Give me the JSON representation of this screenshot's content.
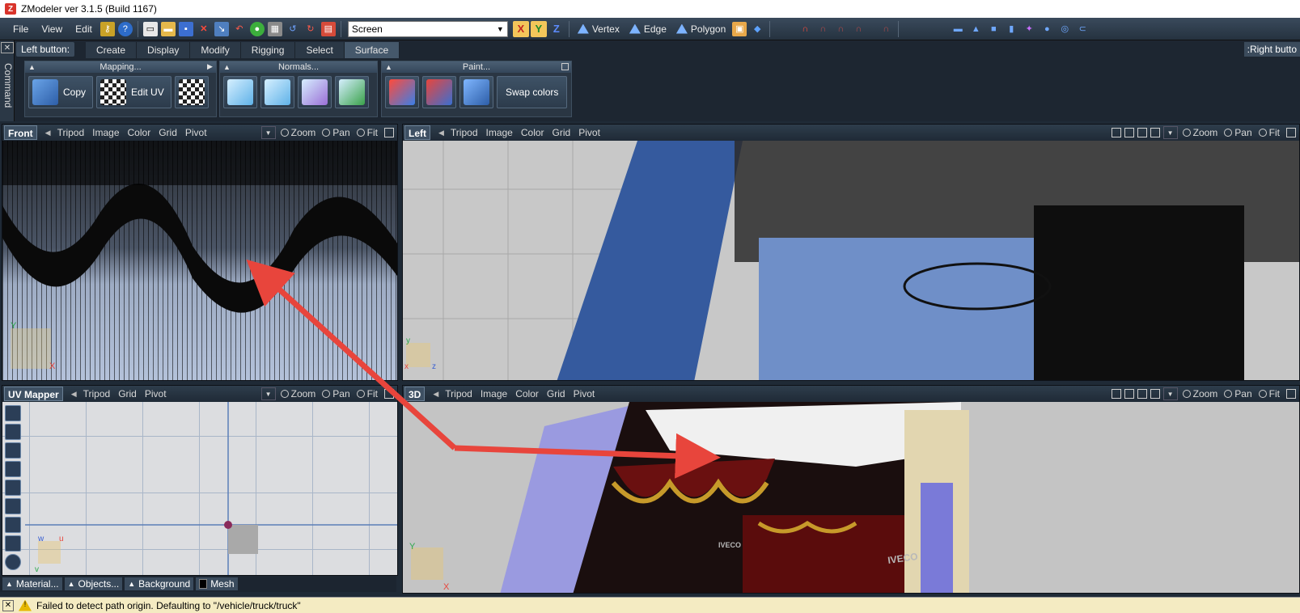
{
  "window": {
    "title": "ZModeler ver 3.1.5 (Build 1167)"
  },
  "menu": {
    "items": [
      "File",
      "View",
      "Edit"
    ]
  },
  "toolbar": {
    "coord_combo_value": "Screen",
    "axis_x": "X",
    "axis_y": "Y",
    "axis_z": "Z",
    "modes": [
      "Vertex",
      "Edge",
      "Polygon"
    ]
  },
  "command": {
    "side_label": "Command",
    "left_button": "Left button:",
    "right_button": ":Right butto",
    "tabs": [
      "Create",
      "Display",
      "Modify",
      "Rigging",
      "Select",
      "Surface"
    ],
    "active_tab": "Surface",
    "groups": {
      "mapping": {
        "title": "Mapping...",
        "copy": "Copy",
        "edit_uv": "Edit UV"
      },
      "normals": {
        "title": "Normals..."
      },
      "paint": {
        "title": "Paint...",
        "swap": "Swap colors"
      }
    }
  },
  "viewports": {
    "front": {
      "title": "Front",
      "links": [
        "Tripod",
        "Image",
        "Color",
        "Grid",
        "Pivot"
      ],
      "zoom": "Zoom",
      "pan": "Pan",
      "fit": "Fit"
    },
    "left": {
      "title": "Left",
      "links": [
        "Tripod",
        "Image",
        "Color",
        "Grid",
        "Pivot"
      ],
      "zoom": "Zoom",
      "pan": "Pan",
      "fit": "Fit",
      "axis_y": "y",
      "axis_z": "z",
      "axis_x": "x"
    },
    "uv": {
      "title": "UV Mapper",
      "links": [
        "Tripod",
        "Grid",
        "Pivot"
      ],
      "zoom": "Zoom",
      "pan": "Pan",
      "fit": "Fit",
      "axis_w": "w",
      "axis_u": "u",
      "axis_v": "v"
    },
    "3d": {
      "title": "3D",
      "links": [
        "Tripod",
        "Image",
        "Color",
        "Grid",
        "Pivot"
      ],
      "zoom": "Zoom",
      "pan": "Pan",
      "fit": "Fit",
      "axis_y": "Y",
      "axis_x": "X",
      "badge1": "IVECO",
      "badge2": "IVECO"
    }
  },
  "uv_bottom": {
    "material": "Material...",
    "objects": "Objects...",
    "background": "Background",
    "mesh": "Mesh"
  },
  "status": {
    "message": "Failed to detect path origin. Defaulting to \"/vehicle/truck/truck\""
  },
  "colors": {
    "annotation_arrow": "#e8453c",
    "status_bg": "#f4ebc2",
    "viewport_3d_bg": "#c4c4c4"
  }
}
